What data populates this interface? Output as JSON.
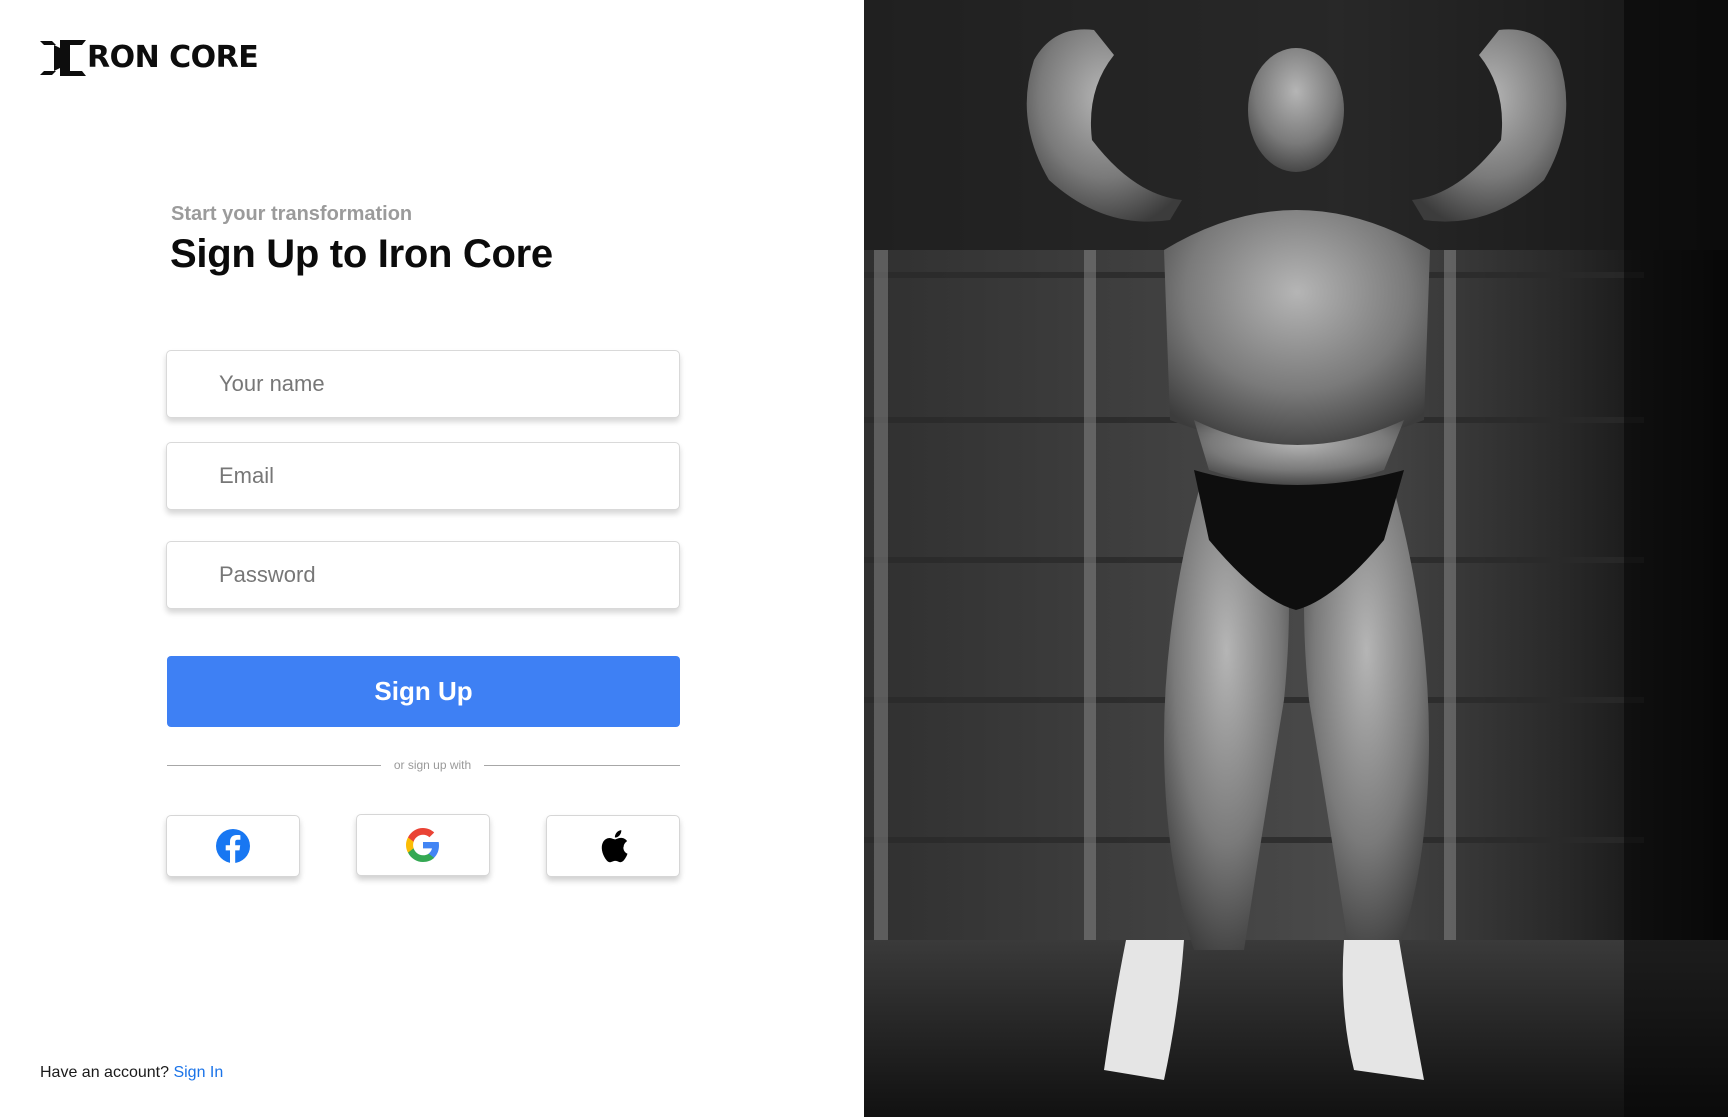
{
  "brand": {
    "name": "RON CORE",
    "logo_icon": "iron-core-i-mark"
  },
  "form": {
    "subtitle": "Start your transformation",
    "title": "Sign Up to Iron Core",
    "name_placeholder": "Your name",
    "email_placeholder": "Email",
    "password_placeholder": "Password",
    "submit_label": "Sign Up",
    "divider_text": "or sign up with"
  },
  "social": [
    {
      "name": "Facebook",
      "icon": "facebook-icon"
    },
    {
      "name": "Google",
      "icon": "google-icon"
    },
    {
      "name": "Apple",
      "icon": "apple-icon"
    }
  ],
  "footer": {
    "prompt": "Have an account?",
    "link": "Sign In"
  },
  "hero_image": {
    "subject": "black-and-white photo of a bodybuilder posing front double biceps in a garage"
  },
  "colors": {
    "primary": "#3e80f4",
    "link": "#1a73e8",
    "subtitle": "#9b9b9b",
    "title": "#0b0b0b"
  }
}
